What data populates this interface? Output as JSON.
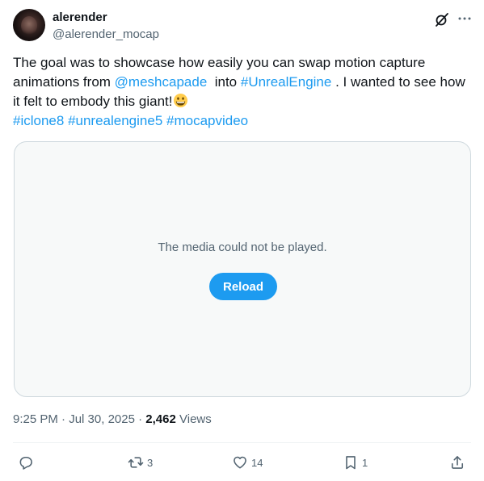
{
  "user": {
    "display_name": "alerender",
    "handle": "@alerender_mocap"
  },
  "tweet": {
    "text_part1": "The goal was to showcase how easily you can swap motion capture animations from ",
    "mention": "@meshcapade",
    "text_part2": "  into ",
    "hashtag_unreal": "#UnrealEngine",
    "text_part3": " . I wanted to see how it felt to embody this giant!",
    "emoji": "grinning-face-icon",
    "hashtags": [
      "#iclone8",
      "#unrealengine5",
      "#mocapvideo"
    ]
  },
  "media": {
    "message": "The media could not be played.",
    "reload_label": "Reload"
  },
  "meta": {
    "time": "9:25 PM",
    "separator": " · ",
    "date": "Jul 30, 2025",
    "views_count": "2,462",
    "views_label": " Views"
  },
  "actions": {
    "reply_count": "",
    "retweet_count": "3",
    "like_count": "14",
    "bookmark_count": "1"
  },
  "colors": {
    "link": "#1d9bf0",
    "text": "#0f1419",
    "secondary": "#536471",
    "button": "#1d9bf0"
  }
}
